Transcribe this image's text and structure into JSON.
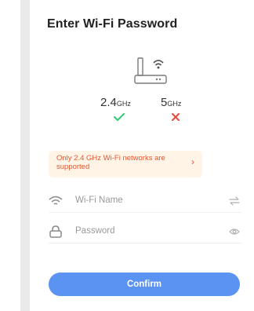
{
  "page": {
    "title": "Enter Wi-Fi Password"
  },
  "bands": [
    {
      "label": "2.4",
      "unit": "GHz",
      "supported": true
    },
    {
      "label": "5",
      "unit": "GHz",
      "supported": false
    }
  ],
  "notice": {
    "text": "Only 2.4 GHz Wi-Fi networks are supported",
    "arrow": "›"
  },
  "form": {
    "wifi_name": {
      "placeholder": "Wi-Fi Name",
      "icon": "wifi-icon",
      "right_icon": "switch-network-icon"
    },
    "password": {
      "placeholder": "Password",
      "icon": "lock-icon",
      "right_icon": "eye-icon"
    }
  },
  "actions": {
    "confirm_label": "Confirm"
  },
  "colors": {
    "accent": "#5a93f2",
    "success": "#2ecc71",
    "error": "#e74c3c",
    "warning_text": "#e8552f",
    "warning_bg": "#fff4e6"
  }
}
